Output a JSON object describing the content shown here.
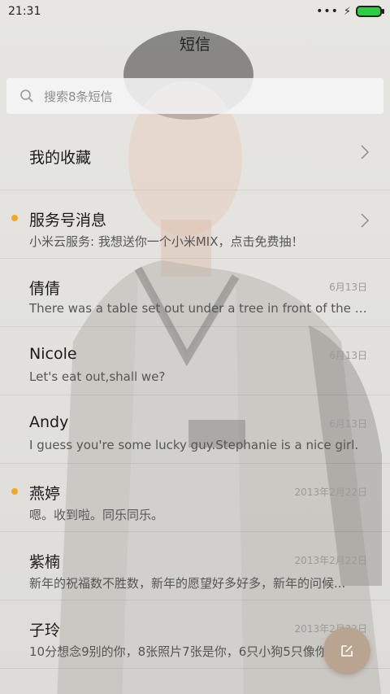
{
  "status_bar": {
    "time": "21:31"
  },
  "header": {
    "title": "短信"
  },
  "search": {
    "placeholder": "搜索8条短信"
  },
  "conversations": [
    {
      "name": "我的收藏",
      "preview": "",
      "date": "",
      "unread": false,
      "chevron": true
    },
    {
      "name": "服务号消息",
      "preview": "小米云服务: 我想送你一个小米MIX，点击免费抽！",
      "date": "",
      "unread": true,
      "chevron": true
    },
    {
      "name": "倩倩",
      "preview": "There was a table set out under a tree in front of the ho...",
      "date": "6月13日",
      "unread": false,
      "chevron": false
    },
    {
      "name": "Nicole",
      "preview": "Let's eat out,shall we?",
      "date": "6月13日",
      "unread": false,
      "chevron": false
    },
    {
      "name": "Andy",
      "preview": "I guess you're some lucky guy.Stephanie is a nice girl.",
      "date": "6月13日",
      "unread": false,
      "chevron": false
    },
    {
      "name": "燕婷",
      "preview": "嗯。收到啦。同乐同乐。",
      "date": "2013年2月22日",
      "unread": true,
      "chevron": false
    },
    {
      "name": "紫楠",
      "preview": "新年的祝福数不胜数，新年的愿望好多好多，新年的问候...",
      "date": "2013年2月22日",
      "unread": false,
      "chevron": false
    },
    {
      "name": "子玲",
      "preview": "10分想念9别的你，8张照片7张是你，6只小狗5只像你...",
      "date": "2013年2月22日",
      "unread": false,
      "chevron": false
    }
  ],
  "colors": {
    "unread_dot": "#f5a623",
    "fab": "#b9a48f",
    "battery": "#2ecc40"
  },
  "icons": {
    "search": "search-icon",
    "chevron": "chevron-right-icon",
    "compose": "compose-icon"
  }
}
